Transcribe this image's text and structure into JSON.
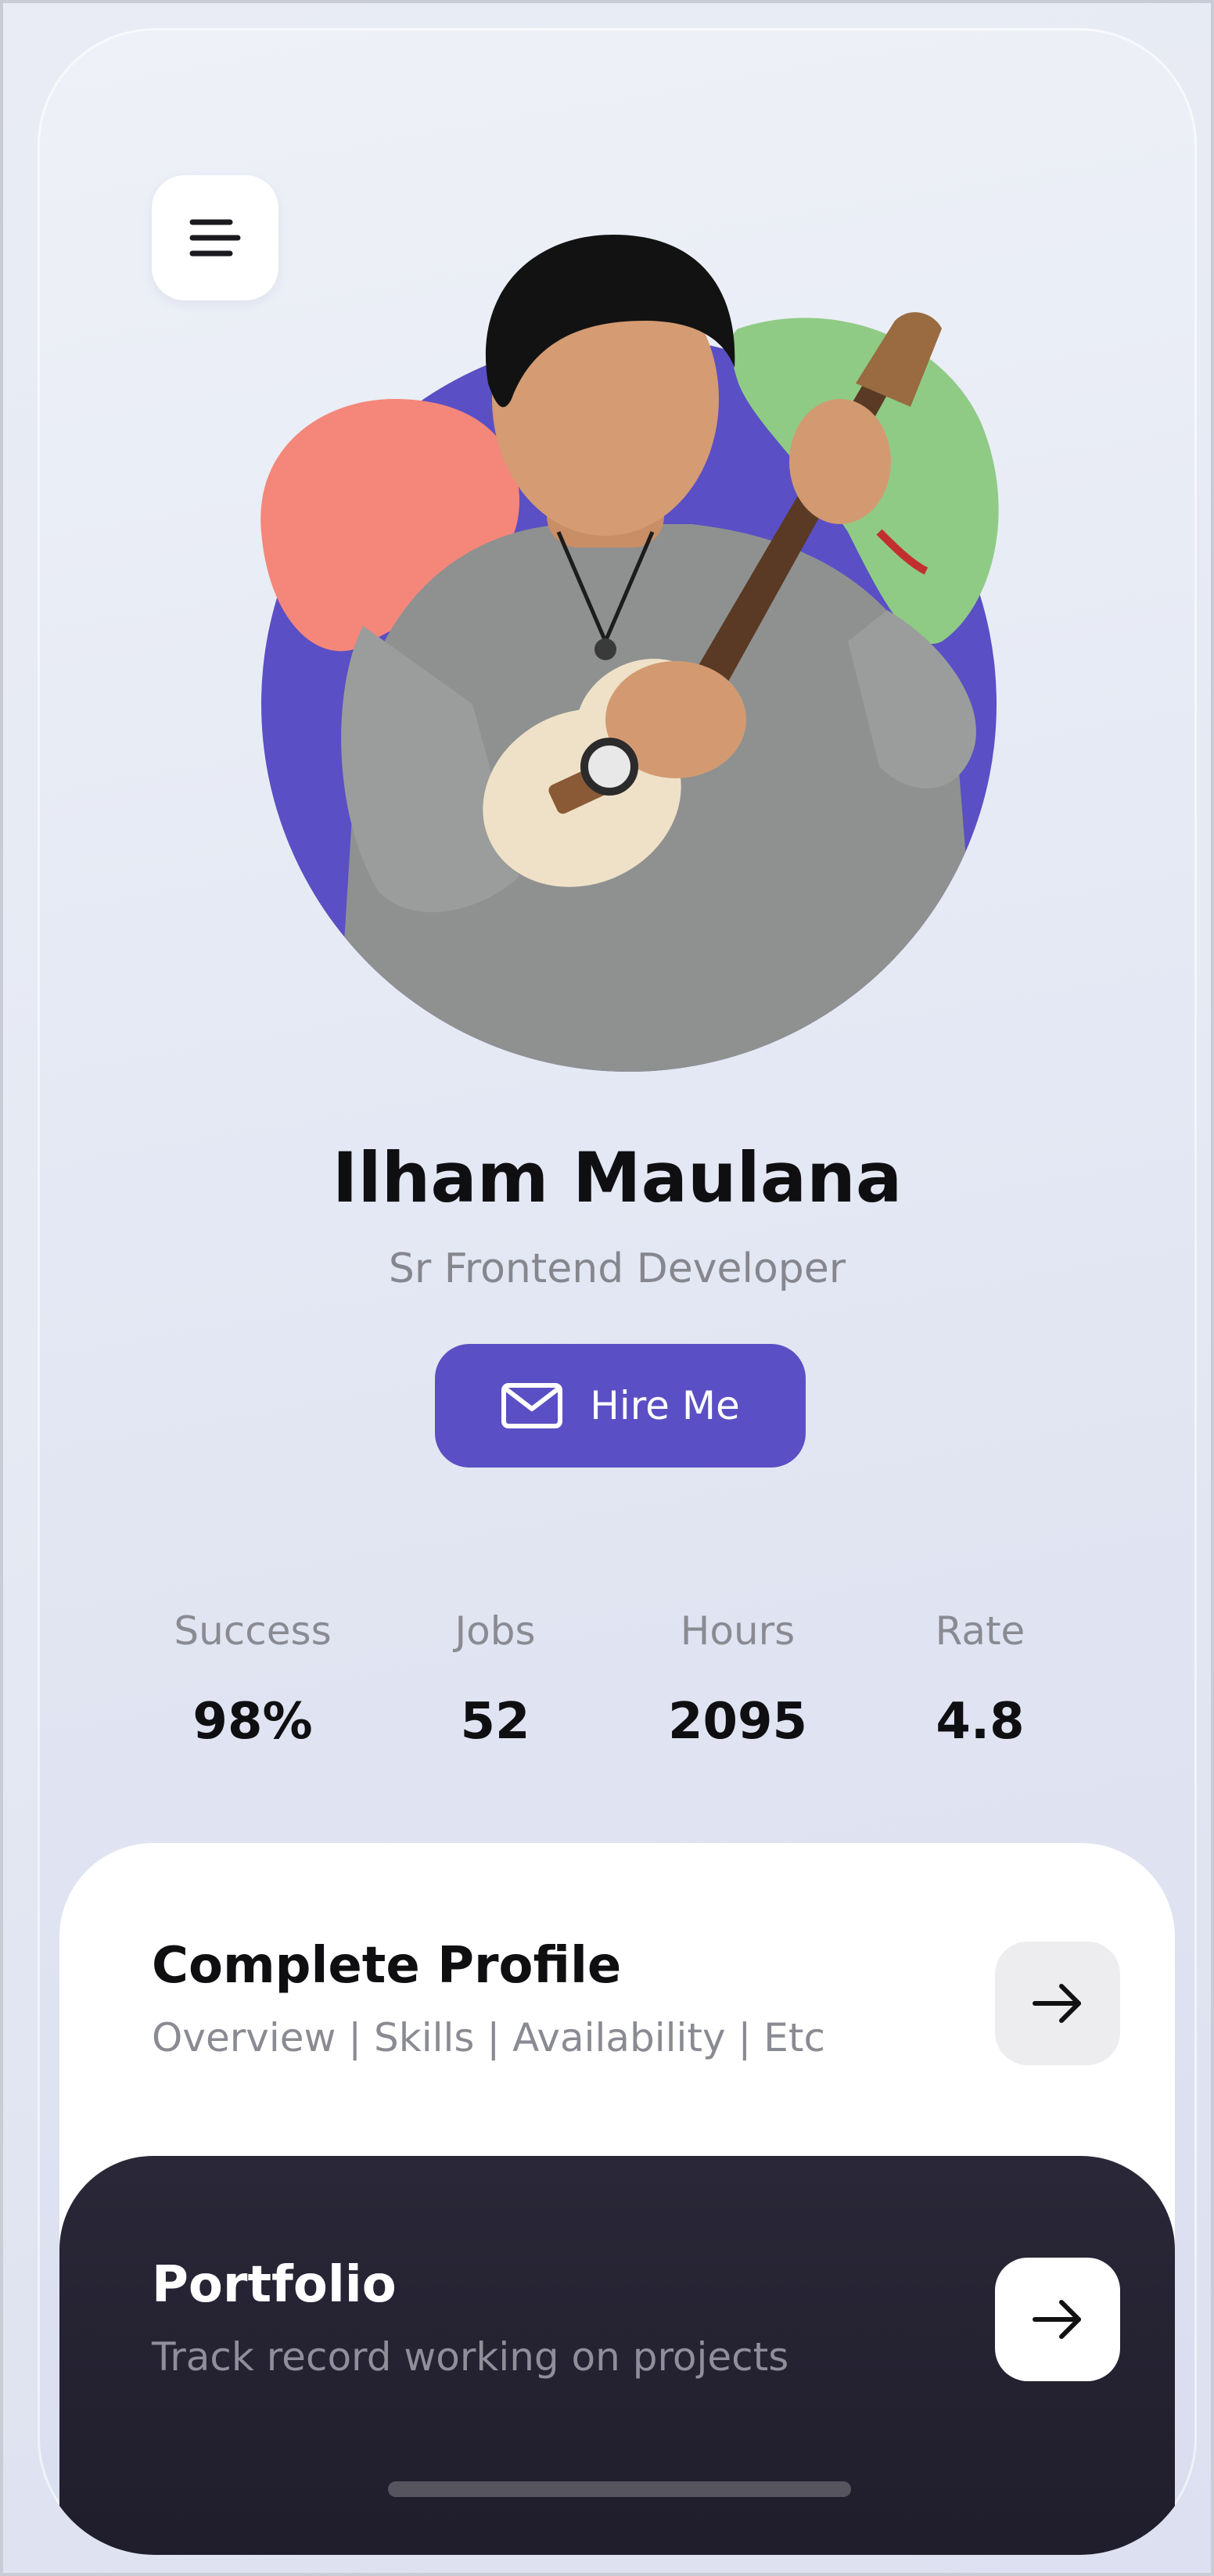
{
  "profile": {
    "name": "Ilham Maulana",
    "title": "Sr Frontend Developer"
  },
  "hire_button": {
    "label": "Hire Me",
    "icon": "mail-icon"
  },
  "menu_button": {
    "icon": "menu-icon"
  },
  "stats": [
    {
      "label": "Success",
      "value": "98%"
    },
    {
      "label": "Jobs",
      "value": "52"
    },
    {
      "label": "Hours",
      "value": "2095"
    },
    {
      "label": "Rate",
      "value": "4.8"
    }
  ],
  "cards": {
    "complete_profile": {
      "title": "Complete Profile",
      "subtitle": "Overview | Skills | Availability | Etc",
      "icon": "arrow-right-icon"
    },
    "portfolio": {
      "title": "Portfolio",
      "subtitle": "Track record working on projects",
      "icon": "arrow-right-icon"
    }
  },
  "colors": {
    "accent": "#5a4fc4",
    "blob_pink": "#f4877a",
    "blob_green": "#8fcb85",
    "dark_card": "#22202e"
  }
}
